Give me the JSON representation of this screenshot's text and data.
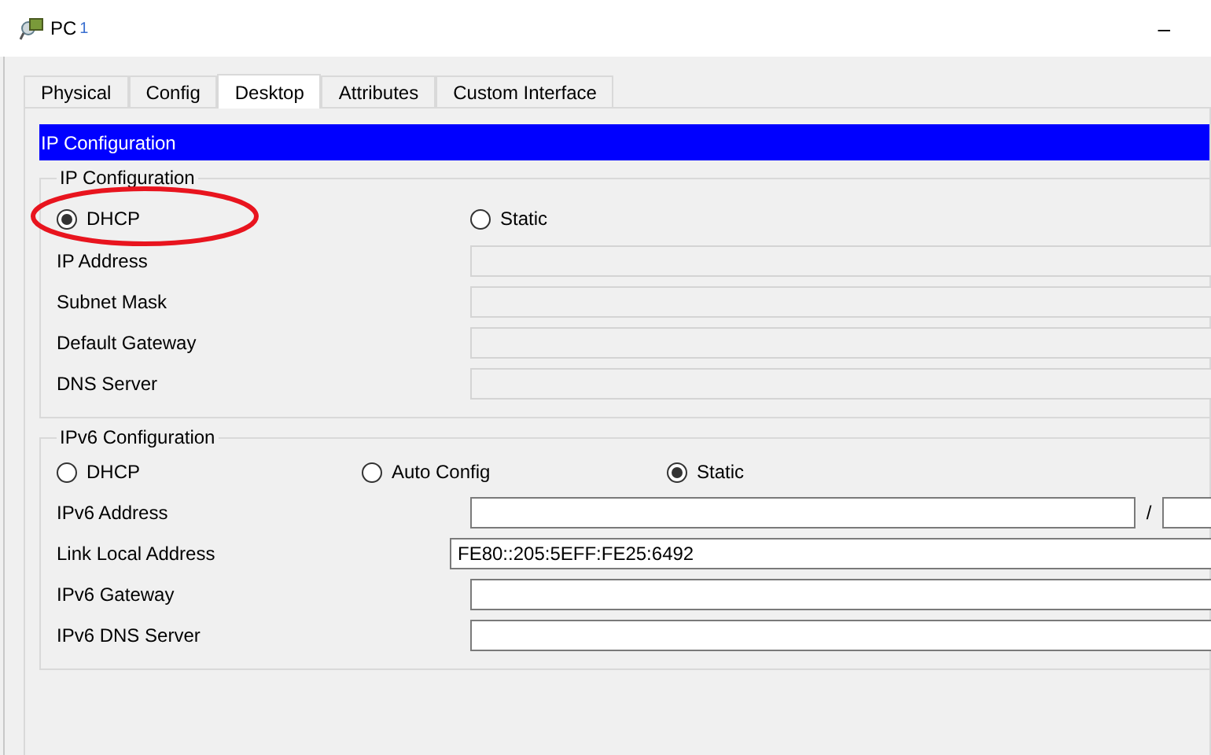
{
  "window": {
    "title": "PC",
    "title_suffix": "1",
    "minimize": "–"
  },
  "tabs": [
    {
      "label": "Physical",
      "selected": false
    },
    {
      "label": "Config",
      "selected": false
    },
    {
      "label": "Desktop",
      "selected": true
    },
    {
      "label": "Attributes",
      "selected": false
    },
    {
      "label": "Custom Interface",
      "selected": false
    }
  ],
  "header": "IP Configuration",
  "ipv4": {
    "legend": "IP Configuration",
    "modes": [
      {
        "label": "DHCP",
        "selected": true,
        "highlighted": true
      },
      {
        "label": "Static",
        "selected": false,
        "highlighted": false
      }
    ],
    "fields": [
      {
        "label": "IP Address",
        "disabled": true
      },
      {
        "label": "Subnet Mask",
        "disabled": true
      },
      {
        "label": "Default Gateway",
        "disabled": true
      },
      {
        "label": "DNS Server",
        "disabled": true
      }
    ]
  },
  "ipv6": {
    "legend": "IPv6 Configuration",
    "modes": [
      {
        "label": "DHCP",
        "selected": false
      },
      {
        "label": "Auto Config",
        "selected": false
      },
      {
        "label": "Static",
        "selected": true
      }
    ],
    "fields": [
      {
        "label": "IPv6 Address",
        "kind": "prefix",
        "separator": "/",
        "disabled": false
      },
      {
        "label": "Link Local Address",
        "kind": "wide",
        "value": "FE80::205:5EFF:FE25:6492",
        "disabled": false
      },
      {
        "label": "IPv6 Gateway",
        "kind": "plain",
        "disabled": false
      },
      {
        "label": "IPv6 DNS Server",
        "kind": "plain",
        "disabled": false
      }
    ]
  },
  "annotation": {
    "color": "#e8141e"
  }
}
